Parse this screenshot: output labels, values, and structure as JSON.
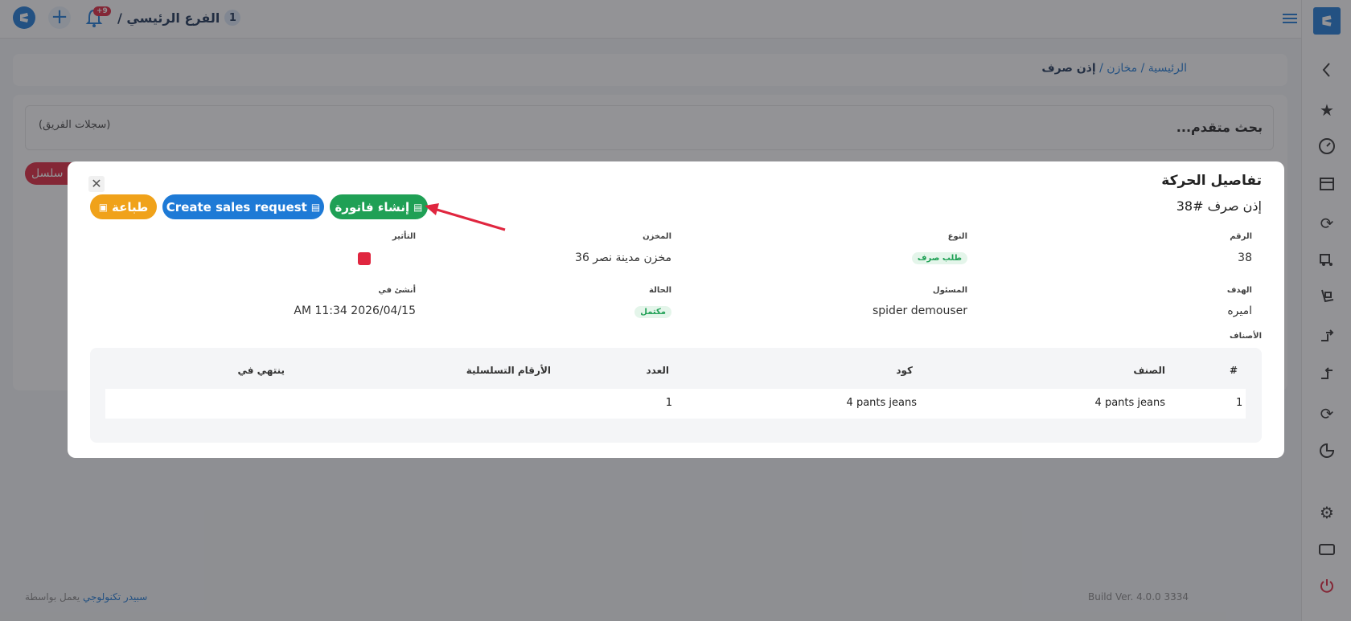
{
  "header": {
    "branch_name": "الفرع الرئيسي /",
    "branch_number": "1",
    "notif_badge": "+9"
  },
  "breadcrumb": {
    "home": "الرئيسية",
    "sep1": "/",
    "warehouses": "مخازن",
    "sep2": "/",
    "current": "إذن صرف"
  },
  "search": {
    "title": "بحث متقدم...",
    "left_label": "(سجلات الفريق)"
  },
  "background_tab": "سلسل",
  "footer": {
    "powered_prefix": "يعمل بواسطة",
    "powered_by": "سبيدر تكنولوجي",
    "build": "Build Ver. 4.0.0 3334"
  },
  "modal": {
    "title": "تفاصيل الحركة",
    "subtitle": "إذن صرف #38",
    "buttons": {
      "print": "طباعة",
      "sales_request": "Create sales request",
      "invoice": "إنشاء فاتورة"
    },
    "fields": {
      "number_label": "الرقم",
      "number_value": "38",
      "type_label": "النوع",
      "type_value": "طلب صرف",
      "warehouse_label": "المخزن",
      "warehouse_value": "مخزن مدينة نصر 36",
      "impact_label": "التأثير",
      "target_label": "الهدف",
      "target_value": "اميره",
      "responsible_label": "المسئول",
      "responsible_value": "spider demouser",
      "status_label": "الحالة",
      "status_value": "مكتمل",
      "created_label": "أنشئ في",
      "created_value": "2026/04/15 11:34 AM",
      "items_label": "الأصناف"
    },
    "table": {
      "headers": [
        "#",
        "الصنف",
        "كود",
        "العدد",
        "الأرقام التسلسلية",
        "ينتهي في"
      ],
      "rows": [
        [
          "1",
          "4 pants jeans",
          "4 pants jeans",
          "1",
          "",
          ""
        ]
      ]
    }
  },
  "colors": {
    "primary": "#1e7ad6",
    "success": "#1fa055",
    "warning": "#f0a21a",
    "danger": "#e0263f"
  }
}
